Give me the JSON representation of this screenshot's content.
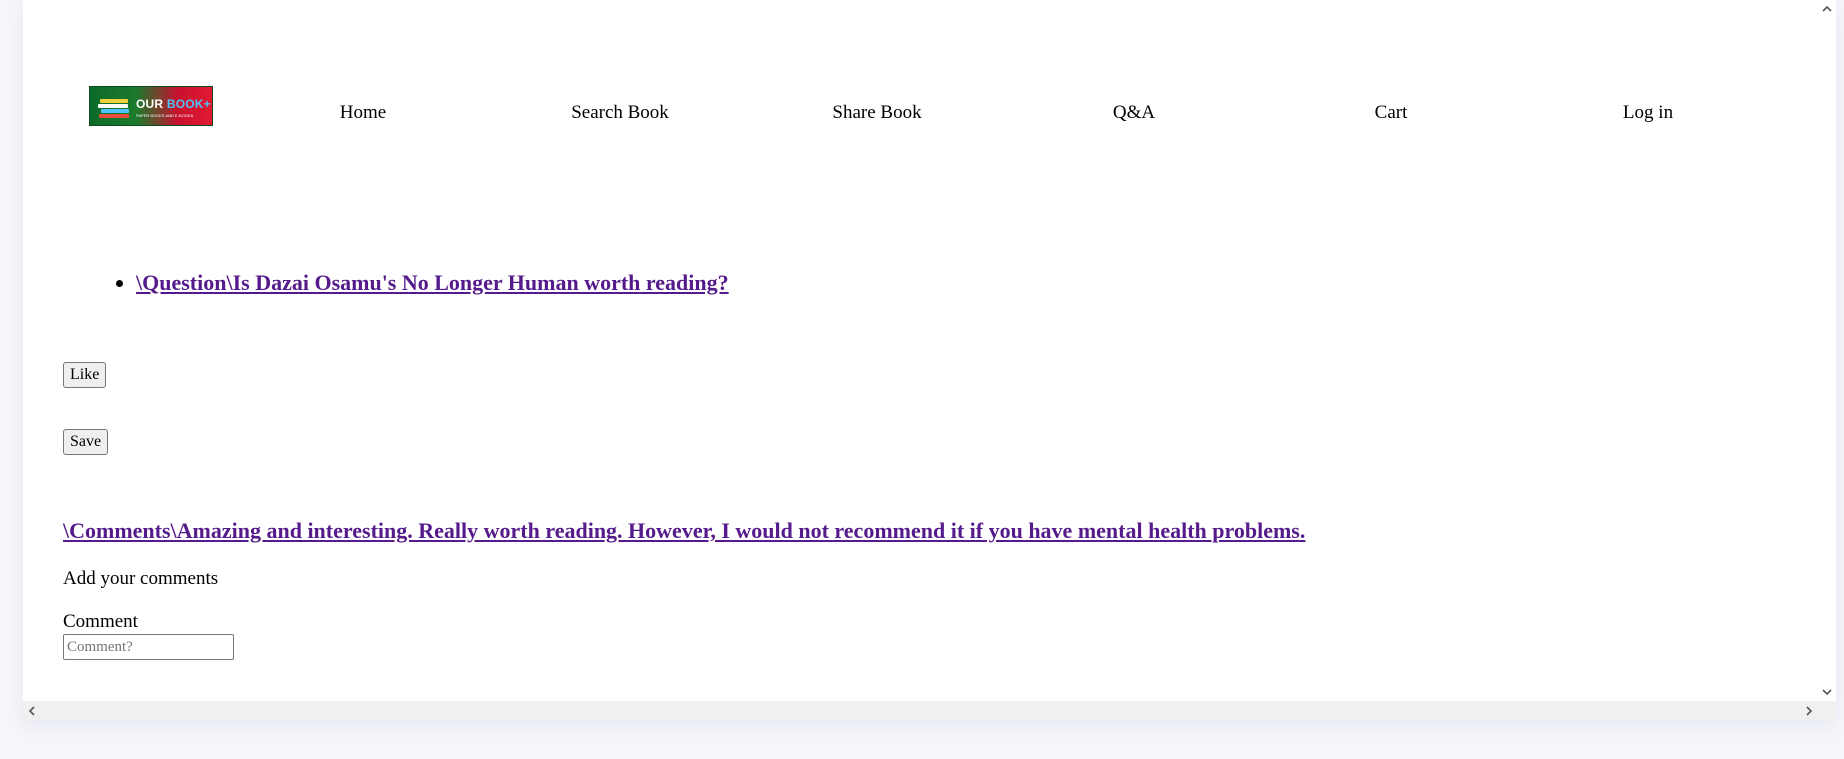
{
  "header": {
    "logo": {
      "brand_main": "OUR",
      "brand_accent": "BOOK+",
      "tagline": "PAPER BOOKS AND E-BOOKS"
    },
    "nav": [
      {
        "label": "Home"
      },
      {
        "label": "Search Book"
      },
      {
        "label": "Share Book"
      },
      {
        "label": "Q&A"
      },
      {
        "label": "Cart"
      },
      {
        "label": "Log in"
      }
    ]
  },
  "question": {
    "link_text": "\\Question\\Is Dazai Osamu's No Longer Human worth reading?"
  },
  "actions": {
    "like_label": "Like",
    "save_label": "Save"
  },
  "comments": {
    "link_text": "\\Comments\\Amazing and interesting. Really worth reading. However, I would not recommend it if you have mental health problems.",
    "add_heading": "Add your comments",
    "field_label": "Comment",
    "field_placeholder": "Comment?",
    "field_value": ""
  },
  "icons": {
    "logo_icon": "stacked-books-icon",
    "scroll_up": "chevron-up-icon",
    "scroll_down": "chevron-down-icon",
    "scroll_left": "chevron-left-icon",
    "scroll_right": "chevron-right-icon"
  },
  "colors": {
    "visited_link": "#551a8b",
    "logo_green": "#0d6b2a",
    "logo_red": "#e11931",
    "logo_accent": "#4fc3f7"
  }
}
